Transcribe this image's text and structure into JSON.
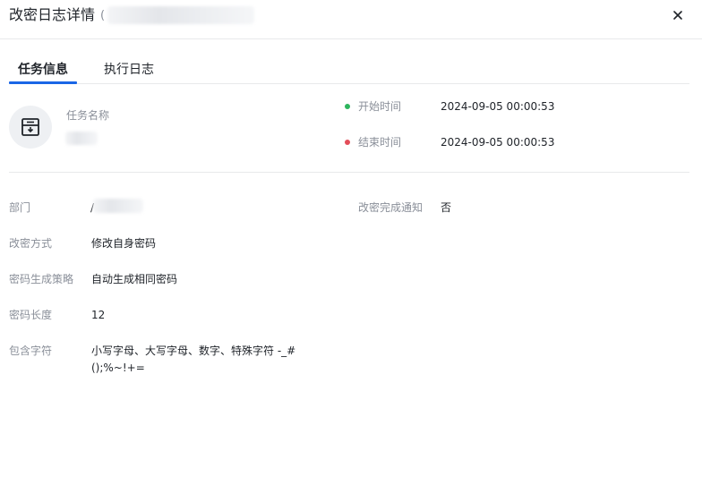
{
  "dialog": {
    "title": "改密日志详情",
    "title_paren": "(",
    "close_icon": "close-icon"
  },
  "tabs": [
    {
      "label": "任务信息",
      "active": true
    },
    {
      "label": "执行日志",
      "active": false
    }
  ],
  "task": {
    "avatar_icon": "task-icon",
    "name_label": "任务名称",
    "start_label": "开始时间",
    "start_value": "2024-09-05 00:00:53",
    "start_dot_color": "#2db55d",
    "end_label": "结束时间",
    "end_value": "2024-09-05 00:00:53",
    "end_dot_color": "#e34d59"
  },
  "details": {
    "department_label": "部门",
    "department_value": "/",
    "notify_label": "改密完成通知",
    "notify_value": "否",
    "method_label": "改密方式",
    "method_value": "修改自身密码",
    "policy_label": "密码生成策略",
    "policy_value": "自动生成相同密码",
    "length_label": "密码长度",
    "length_value": "12",
    "chars_label": "包含字符",
    "chars_line1": "小写字母、大写字母、数字、特殊字符 -_#",
    "chars_line2": "();%~!+="
  },
  "colors": {
    "accent": "#1a66e6",
    "text": "#1f2329",
    "muted": "#8a8f99",
    "border": "#e8e9eb"
  }
}
